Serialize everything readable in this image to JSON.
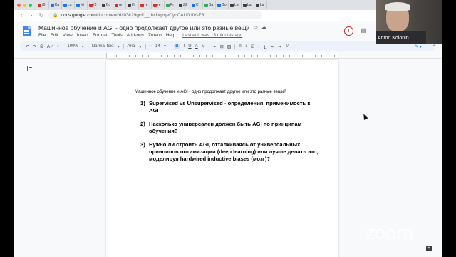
{
  "browser": {
    "traffic_colors": [
      "#ff5f57",
      "#febc2e",
      "#28c840"
    ],
    "tabs": [
      {
        "label": "(0",
        "color": "#d93025"
      },
      {
        "label": "Ka",
        "color": "#1a73e8"
      },
      {
        "label": "Lu",
        "color": "#1a73e8"
      },
      {
        "label": "Mi",
        "color": "#1a73e8"
      },
      {
        "label": "(0",
        "color": "#d93025"
      },
      {
        "label": "Bc",
        "color": "#3c4043"
      },
      {
        "label": "re",
        "color": "#d93025"
      },
      {
        "label": "Hi",
        "color": "#3c4043"
      },
      {
        "label": "re",
        "color": "#d93025"
      },
      {
        "label": "re",
        "color": "#d93025"
      },
      {
        "label": "Pr",
        "color": "#34a853"
      },
      {
        "label": "Z2",
        "color": "#3c4043"
      },
      {
        "label": "Cr",
        "color": "#1a73e8"
      },
      {
        "label": "Ba",
        "color": "#34a853"
      },
      {
        "label": "Go",
        "color": "#1a73e8"
      },
      {
        "label": "La",
        "color": "#3c4043"
      },
      {
        "label": "La",
        "color": "#3c4043"
      },
      {
        "label": "La",
        "color": "#3c4043"
      }
    ],
    "url_host": "docs.google.com",
    "url_path": "/document/d/1Gk29gcK__dV1tqzqeCycCALi0dlVsZ8..."
  },
  "docs": {
    "title": "Машинное обучение и AGI - одно продолжает другое или это разные вещи",
    "menu": [
      "File",
      "Edit",
      "View",
      "Insert",
      "Format",
      "Tools",
      "Add-ons",
      "Zotero",
      "Help"
    ],
    "last_edit": "Last edit was 13 minutes ago",
    "avatar_letter": "T"
  },
  "toolbar": {
    "zoom": "100%",
    "style": "Normal text",
    "font": "Arial",
    "size": "14",
    "bold": "B",
    "italic": "I",
    "underline": "U",
    "text_color": "A"
  },
  "document": {
    "heading": "Машинное обучение и AGI - одно продолжает другое или это разные вещи?",
    "items": [
      {
        "num": "1)",
        "text": "Supervised vs Unsupervised - определения, применимость к AGI"
      },
      {
        "num": "2)",
        "text": "Насколько универсален должен быть AGI по принципам обучения?"
      },
      {
        "num": "3)",
        "text": "Нужно ли строить AGI, отталкиваясь от универсальных принципов оптимизации (deep learning) или лучше делать это, моделируя hardwired inductive biases (мозг)?"
      }
    ]
  },
  "zoom_overlay": {
    "participant_name": "Anton Kolonin",
    "watermark": "zoom"
  }
}
